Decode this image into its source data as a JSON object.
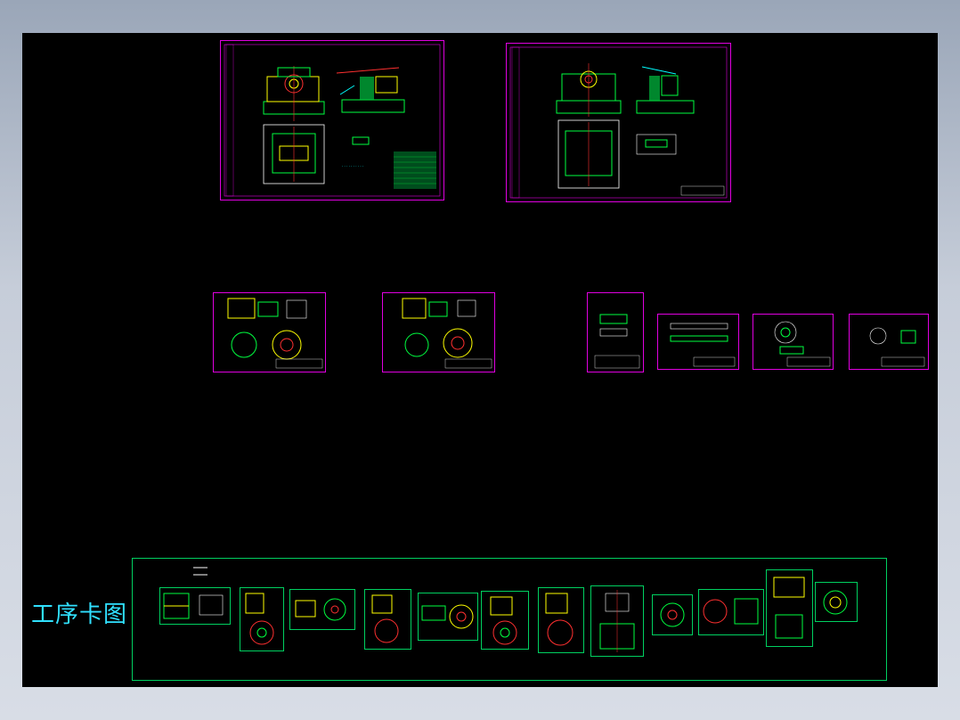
{
  "labels": {
    "process_card_title": "工序卡图"
  },
  "colors": {
    "background": "#000000",
    "sheet_border": "#e000e0",
    "card_border": "#00d060",
    "label": "#30e0ff",
    "line_green": "#00ff40",
    "line_yellow": "#ffff00",
    "line_red": "#ff3030",
    "line_cyan": "#00ffff",
    "line_white": "#ffffff"
  }
}
